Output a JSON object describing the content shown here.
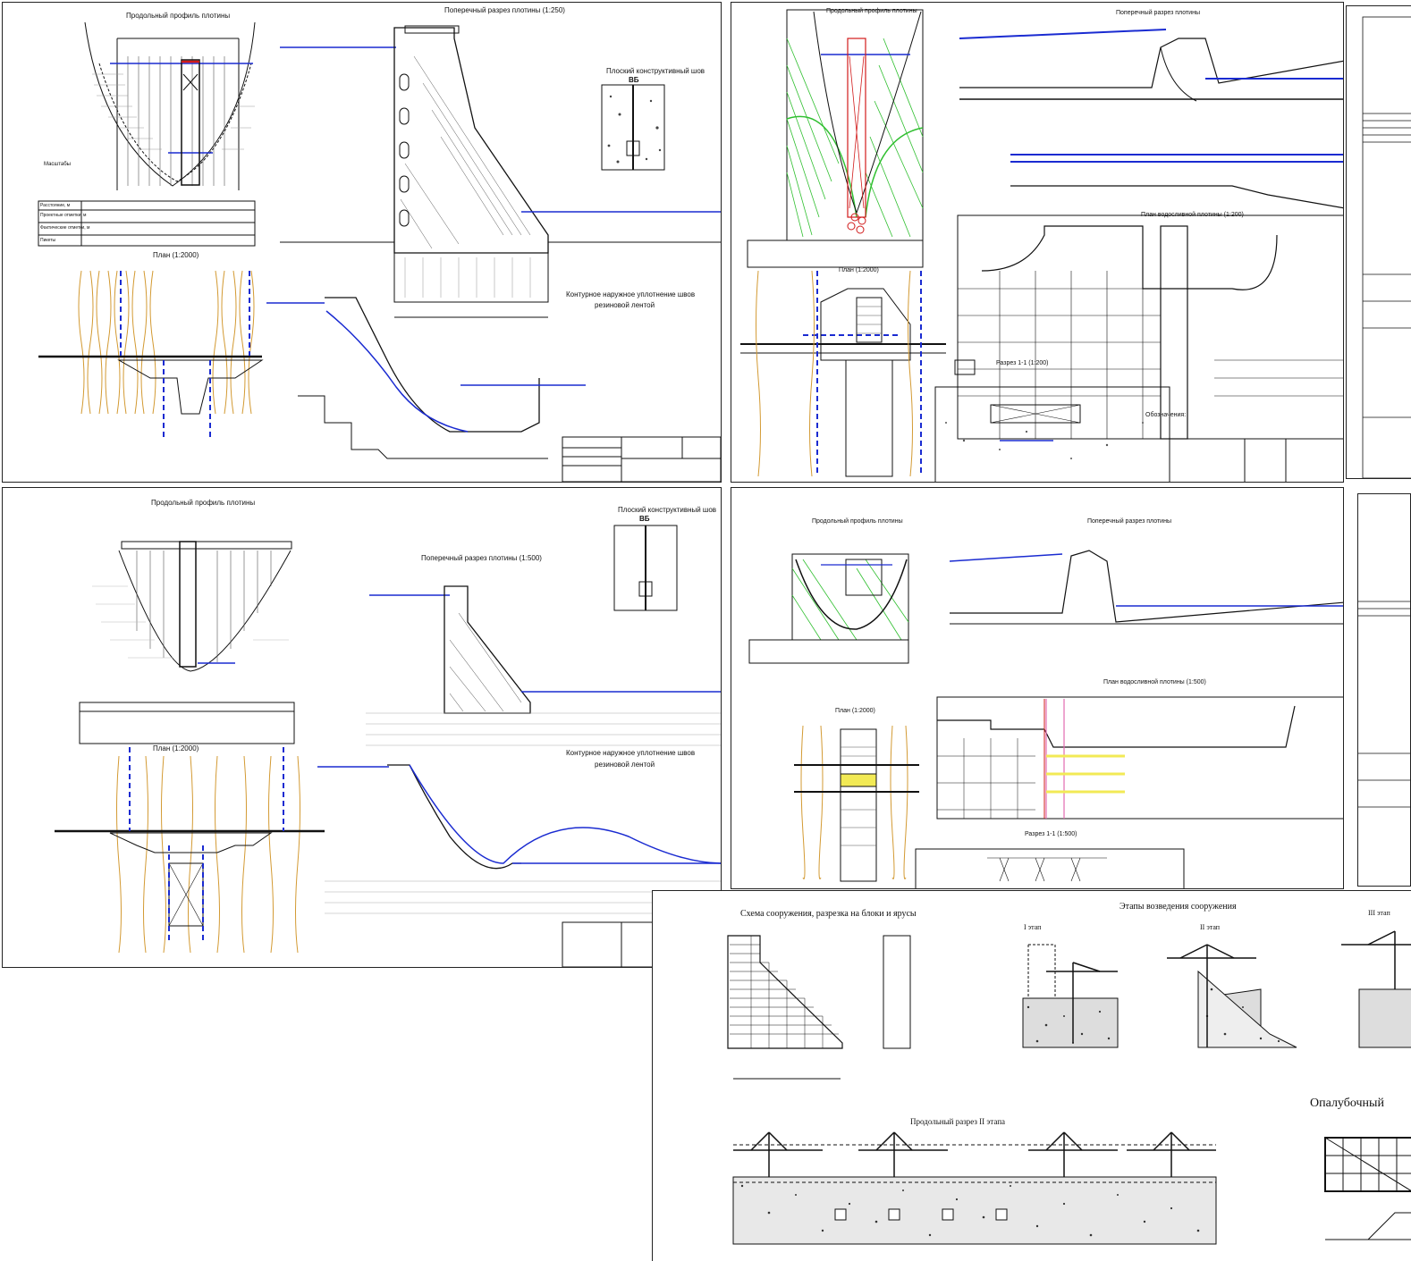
{
  "colors": {
    "line": "#111111",
    "water": "#1a2bd1",
    "green": "#2fbf2f",
    "wood": "#d39a33",
    "red": "#d11a1a",
    "yellow": "#f2ea55",
    "pink": "#e36bb0"
  },
  "sheet1": {
    "long_profile_title": "Продольный профиль плотины",
    "cross_section_title": "Поперечный разрез плотины (1:250)",
    "plan_title": "План (1:2000)",
    "joint_title": "Плоский конструктивный шов",
    "joint_label": "ВБ",
    "seal_title_1": "Контурное наружное уплотнение швов",
    "seal_title_2": "резиновой лентой",
    "scales": "Масштабы",
    "table_rows": [
      "Расстояние, м",
      "Проектные отметки, м",
      "Фактические отметки, м",
      "Пикеты"
    ]
  },
  "sheet2": {
    "long_profile_title": "Продольный профиль плотины",
    "cross_section_title": "Поперечный разрез плотины",
    "plan_title": "План (1:2000)",
    "spillway_plan_title": "План водосливной плотины (1:200)",
    "section_title": "Разрез 1-1 (1:200)",
    "legend_title": "Обозначения:"
  },
  "sheet3": {
    "long_profile_title": "Продольный профиль плотины",
    "cross_section_title": "Поперечный разрез плотины (1:500)",
    "plan_title": "План (1:2000)",
    "joint_title": "Плоский конструктивный шов",
    "joint_label": "ВБ",
    "seal_title_1": "Контурное наружное уплотнение швов",
    "seal_title_2": "резиновой лентой"
  },
  "sheet4": {
    "long_profile_title": "Продольный профиль плотины",
    "cross_section_title": "Поперечный разрез плотины",
    "plan_title": "План (1:2000)",
    "spillway_plan_title": "План водосливной плотины (1:500)",
    "section_title": "Разрез 1-1 (1:500)"
  },
  "sheet5": {
    "scheme_title": "Схема сооружения, разрезка на блоки и ярусы",
    "stages_title": "Этапы возведения сооружения",
    "stage1": "I этап",
    "stage2": "II этап",
    "stage3": "III этап",
    "long_section_title": "Продольный разрез II этапа",
    "formwork_title": "Опалубочный"
  }
}
